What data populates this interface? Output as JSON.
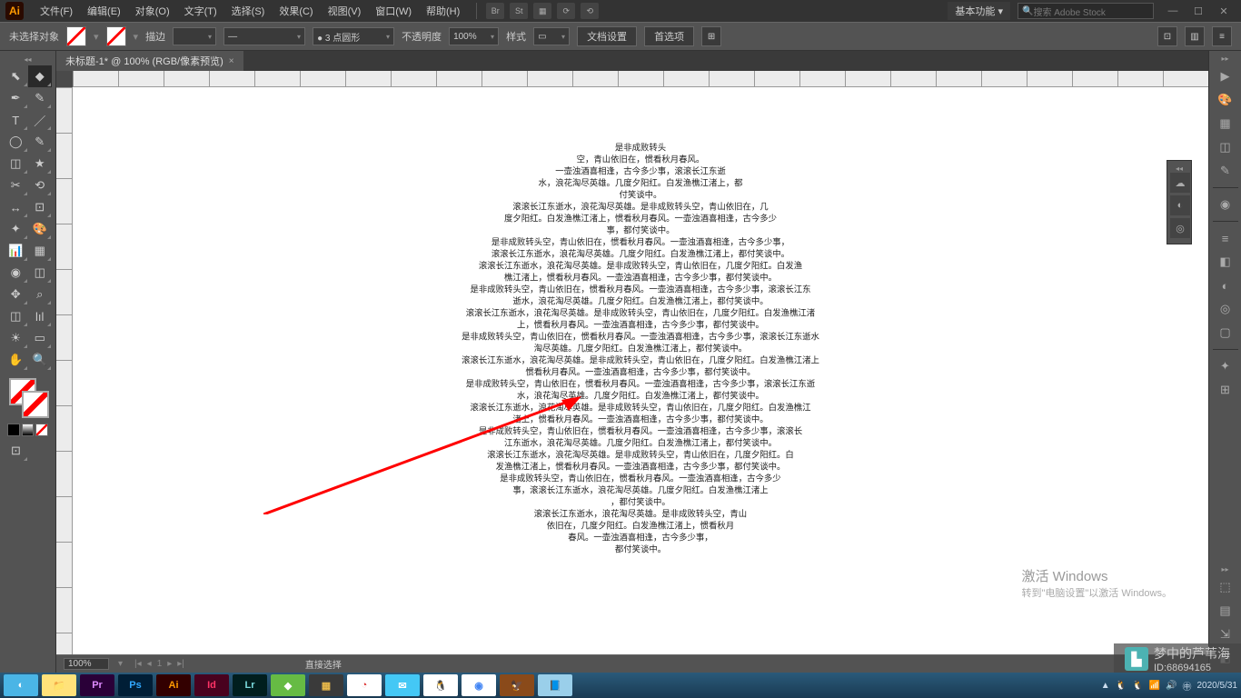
{
  "menu": {
    "items": [
      "文件(F)",
      "编辑(E)",
      "对象(O)",
      "文字(T)",
      "选择(S)",
      "效果(C)",
      "视图(V)",
      "窗口(W)",
      "帮助(H)"
    ],
    "basic_fn": "基本功能",
    "search_ph": "搜索 Adobe Stock"
  },
  "ctrl": {
    "noselect": "未选择对象",
    "stroke_lbl": "描边",
    "point_style": "3 点圆形",
    "opacity_lbl": "不透明度",
    "opacity_val": "100%",
    "style_lbl": "样式",
    "btn_doc": "文档设置",
    "btn_pref": "首选项"
  },
  "doc": {
    "tab": "未标题-1* @ 100% (RGB/像素预览)"
  },
  "text_lines": [
    "是非成败转头",
    "空，青山依旧在，惯看秋月春风。",
    "一壶浊酒喜相逢，古今多少事，滚滚长江东逝",
    "水，浪花淘尽英雄。几度夕阳红。白发渔樵江渚上，都",
    "付笑谈中。",
    "滚滚长江东逝水，浪花淘尽英雄。是非成败转头空，青山依旧在，几",
    "度夕阳红。白发渔樵江渚上，惯看秋月春风。一壶浊酒喜相逢，古今多少",
    "事，都付笑谈中。",
    "是非成败转头空，青山依旧在，惯看秋月春风。一壶浊酒喜相逢，古今多少事，",
    "滚滚长江东逝水，浪花淘尽英雄。几度夕阳红。白发渔樵江渚上，都付笑谈中。",
    "滚滚长江东逝水，浪花淘尽英雄。是非成败转头空，青山依旧在，几度夕阳红。白发渔",
    "樵江渚上，惯看秋月春风。一壶浊酒喜相逢，古今多少事，都付笑谈中。",
    "是非成败转头空，青山依旧在，惯看秋月春风。一壶浊酒喜相逢，古今多少事，滚滚长江东",
    "逝水，浪花淘尽英雄。几度夕阳红。白发渔樵江渚上，都付笑谈中。",
    "滚滚长江东逝水，浪花淘尽英雄。是非成败转头空，青山依旧在，几度夕阳红。白发渔樵江渚",
    "上，惯看秋月春风。一壶浊酒喜相逢，古今多少事，都付笑谈中。",
    "是非成败转头空，青山依旧在，惯看秋月春风。一壶浊酒喜相逢，古今多少事，滚滚长江东逝水",
    "淘尽英雄。几度夕阳红。白发渔樵江渚上，都付笑谈中。",
    "滚滚长江东逝水，浪花淘尽英雄。是非成败转头空，青山依旧在，几度夕阳红。白发渔樵江渚上",
    "惯看秋月春风。一壶浊酒喜相逢，古今多少事，都付笑谈中。",
    "是非成败转头空，青山依旧在，惯看秋月春风。一壶浊酒喜相逢，古今多少事，滚滚长江东逝",
    "水，浪花淘尽英雄。几度夕阳红。白发渔樵江渚上，都付笑谈中。",
    "滚滚长江东逝水，浪花淘尽英雄。是非成败转头空，青山依旧在，几度夕阳红。白发渔樵江",
    "渚上，惯看秋月春风。一壶浊酒喜相逢，古今多少事，都付笑谈中。",
    "是非成败转头空，青山依旧在，惯看秋月春风。一壶浊酒喜相逢，古今多少事，滚滚长",
    "江东逝水，浪花淘尽英雄。几度夕阳红。白发渔樵江渚上，都付笑谈中。",
    "滚滚长江东逝水，浪花淘尽英雄。是非成败转头空，青山依旧在，几度夕阳红。白",
    "发渔樵江渚上，惯看秋月春风。一壶浊酒喜相逢，古今多少事，都付笑谈中。",
    "是非成败转头空，青山依旧在，惯看秋月春风。一壶浊酒喜相逢，古今多少",
    "事，滚滚长江东逝水，浪花淘尽英雄。几度夕阳红。白发渔樵江渚上",
    "，都付笑谈中。",
    "滚滚长江东逝水，浪花淘尽英雄。是非成败转头空，青山",
    "依旧在，几度夕阳红。白发渔樵江渚上，惯看秋月",
    "春风。一壶浊酒喜相逢，古今多少事，",
    "都付笑谈中。"
  ],
  "status": {
    "zoom": "100%",
    "artboard": "1",
    "tool": "直接选择"
  },
  "activation": {
    "title": "激活 Windows",
    "sub": "转到\"电脑设置\"以激活 Windows。"
  },
  "watermark": {
    "name": "梦中的芦苇海",
    "id": "ID:68694165"
  },
  "clock": "2020/5/31",
  "apps": [
    {
      "bg": "#4ab5e6",
      "fg": "#fff",
      "t": "◐"
    },
    {
      "bg": "#ffe27a",
      "fg": "#b76b00",
      "t": "📁"
    },
    {
      "bg": "#2a0038",
      "fg": "#df8bff",
      "t": "Pr"
    },
    {
      "bg": "#001e36",
      "fg": "#31a8ff",
      "t": "Ps"
    },
    {
      "bg": "#330000",
      "fg": "#ff9a00",
      "t": "Ai"
    },
    {
      "bg": "#49021f",
      "fg": "#ff3366",
      "t": "Id"
    },
    {
      "bg": "#001e1e",
      "fg": "#7adadd",
      "t": "Lr"
    },
    {
      "bg": "#66bb44",
      "fg": "#fff",
      "t": "◆"
    },
    {
      "bg": "#3a3a3a",
      "fg": "#e8b84a",
      "t": "▦"
    },
    {
      "bg": "#fff",
      "fg": "#d33",
      "t": "◔"
    },
    {
      "bg": "#44c8f5",
      "fg": "#fff",
      "t": "✉"
    },
    {
      "bg": "#fff",
      "fg": "#333",
      "t": "🐧"
    },
    {
      "bg": "#fff",
      "fg": "#4285f4",
      "t": "◉"
    },
    {
      "bg": "#8a4a1a",
      "fg": "#fff",
      "t": "🦅"
    },
    {
      "bg": "#9acfea",
      "fg": "#fff",
      "t": "📘"
    }
  ]
}
